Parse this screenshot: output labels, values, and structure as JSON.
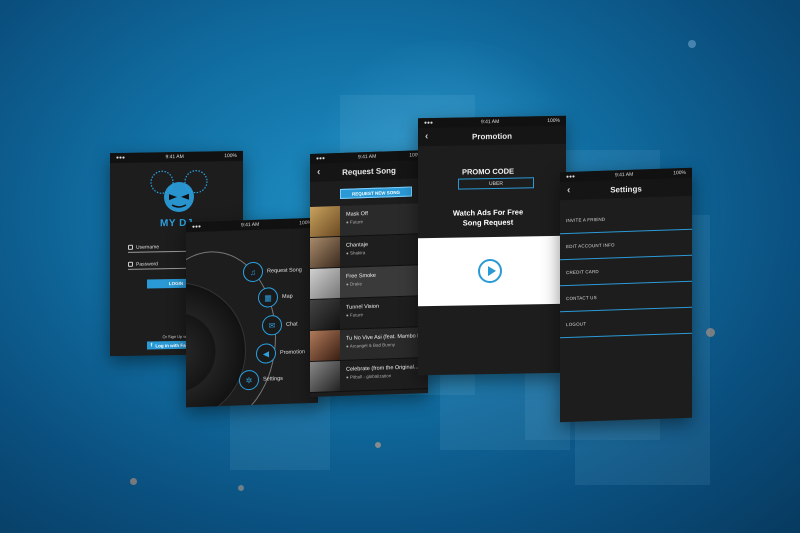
{
  "status_bar": {
    "time": "9:41 AM",
    "battery": "100%"
  },
  "login": {
    "app_name": "MY DJ",
    "username_placeholder": "Username",
    "password_placeholder": "Password",
    "login_label": "LOGIN",
    "signup_note": "Or Sign Up with",
    "facebook_label": "Log in with Facebook"
  },
  "menu": {
    "items": [
      {
        "label": "Request Song",
        "icon": "music-note-icon"
      },
      {
        "label": "Map",
        "icon": "map-icon"
      },
      {
        "label": "Chat",
        "icon": "chat-icon"
      },
      {
        "label": "Promotion",
        "icon": "megaphone-icon"
      },
      {
        "label": "Settings",
        "icon": "gear-icon"
      }
    ]
  },
  "request_song": {
    "title": "Request Song",
    "new_song_button": "REQUEST NEW SONG",
    "songs": [
      {
        "title": "Mask Off",
        "artist": "● Future"
      },
      {
        "title": "Chantaje",
        "artist": "● Shakira"
      },
      {
        "title": "Free Smoke",
        "artist": "● Drake"
      },
      {
        "title": "Tunnel Vision",
        "artist": "● Future"
      },
      {
        "title": "Tu No Vive Asi (feat. Mambo Kings)",
        "artist": "● Arcangel & Bad Bunny"
      },
      {
        "title": "Celebrate (from the Original...",
        "artist": "● Pitbull - globalization"
      }
    ]
  },
  "promotion": {
    "title": "Promotion",
    "promo_label": "PROMO CODE",
    "promo_value": "UBER",
    "watch_line1": "Watch Ads For Free",
    "watch_line2": "Song Request"
  },
  "settings": {
    "title": "Settings",
    "items": [
      "INVITE A FRIEND",
      "EDIT ACCOUNT INFO",
      "CREDIT CARD",
      "CONTACT US",
      "LOGOUT"
    ]
  },
  "colors": {
    "accent": "#2a9ad6",
    "screen_bg": "#1d1d1d",
    "background": "#116fa3"
  }
}
